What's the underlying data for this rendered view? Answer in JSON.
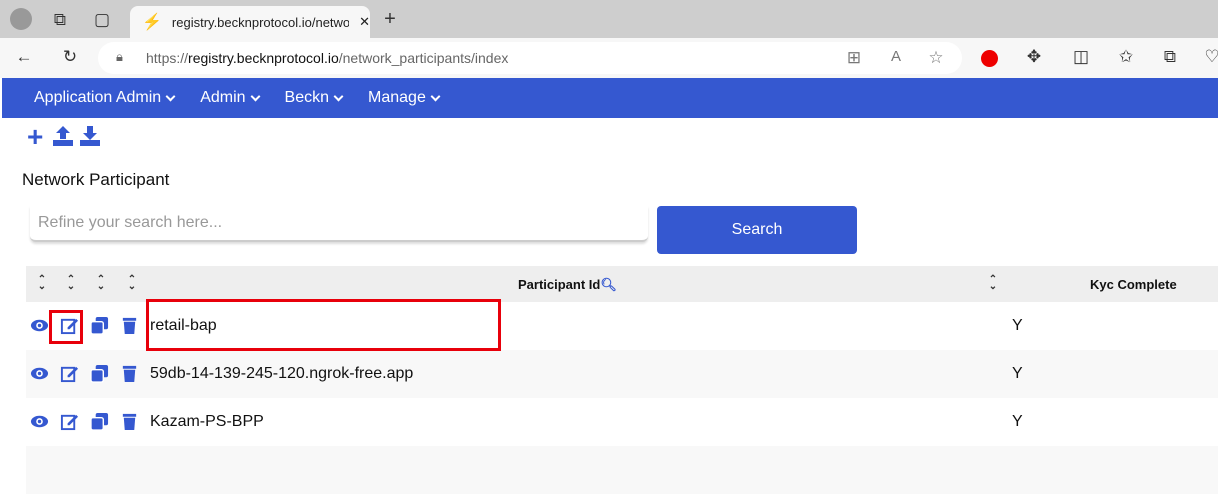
{
  "browser": {
    "tab_title": "registry.becknprotocol.io/network_participants/index",
    "url_scheme": "https://",
    "url_host": "registry.becknprotocol.io",
    "url_path": "/network_participants/index"
  },
  "nav": {
    "items": [
      {
        "label": "Application Admin"
      },
      {
        "label": "Admin"
      },
      {
        "label": "Beckn"
      },
      {
        "label": "Manage"
      }
    ]
  },
  "page": {
    "title": "Network Participant",
    "search_placeholder": "Refine your search here...",
    "search_button": "Search"
  },
  "table": {
    "columns": [
      "Participant Id",
      "Kyc Complete"
    ],
    "rows": [
      {
        "participant_id": "retail-bap",
        "kyc_complete": "Y"
      },
      {
        "participant_id": "59db-14-139-245-120.ngrok-free.app",
        "kyc_complete": "Y"
      },
      {
        "participant_id": "Kazam-PS-BPP",
        "kyc_complete": "Y"
      }
    ]
  },
  "colors": {
    "brand": "#3558d0",
    "highlight": "#e8000b"
  }
}
